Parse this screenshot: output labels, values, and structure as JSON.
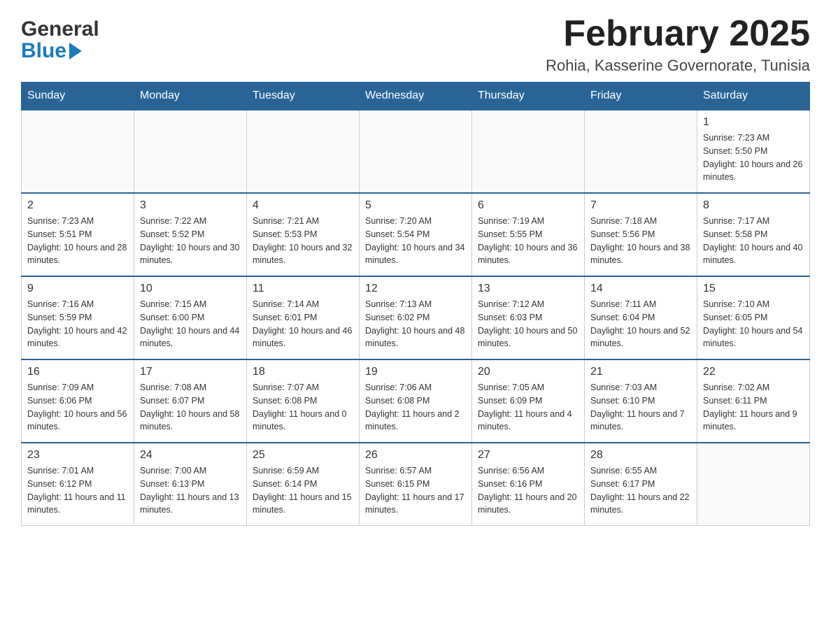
{
  "header": {
    "logo_general": "General",
    "logo_blue": "Blue",
    "month_title": "February 2025",
    "location": "Rohia, Kasserine Governorate, Tunisia"
  },
  "days_of_week": [
    "Sunday",
    "Monday",
    "Tuesday",
    "Wednesday",
    "Thursday",
    "Friday",
    "Saturday"
  ],
  "weeks": [
    {
      "days": [
        {
          "number": "",
          "sunrise": "",
          "sunset": "",
          "daylight": ""
        },
        {
          "number": "",
          "sunrise": "",
          "sunset": "",
          "daylight": ""
        },
        {
          "number": "",
          "sunrise": "",
          "sunset": "",
          "daylight": ""
        },
        {
          "number": "",
          "sunrise": "",
          "sunset": "",
          "daylight": ""
        },
        {
          "number": "",
          "sunrise": "",
          "sunset": "",
          "daylight": ""
        },
        {
          "number": "",
          "sunrise": "",
          "sunset": "",
          "daylight": ""
        },
        {
          "number": "1",
          "sunrise": "Sunrise: 7:23 AM",
          "sunset": "Sunset: 5:50 PM",
          "daylight": "Daylight: 10 hours and 26 minutes."
        }
      ]
    },
    {
      "days": [
        {
          "number": "2",
          "sunrise": "Sunrise: 7:23 AM",
          "sunset": "Sunset: 5:51 PM",
          "daylight": "Daylight: 10 hours and 28 minutes."
        },
        {
          "number": "3",
          "sunrise": "Sunrise: 7:22 AM",
          "sunset": "Sunset: 5:52 PM",
          "daylight": "Daylight: 10 hours and 30 minutes."
        },
        {
          "number": "4",
          "sunrise": "Sunrise: 7:21 AM",
          "sunset": "Sunset: 5:53 PM",
          "daylight": "Daylight: 10 hours and 32 minutes."
        },
        {
          "number": "5",
          "sunrise": "Sunrise: 7:20 AM",
          "sunset": "Sunset: 5:54 PM",
          "daylight": "Daylight: 10 hours and 34 minutes."
        },
        {
          "number": "6",
          "sunrise": "Sunrise: 7:19 AM",
          "sunset": "Sunset: 5:55 PM",
          "daylight": "Daylight: 10 hours and 36 minutes."
        },
        {
          "number": "7",
          "sunrise": "Sunrise: 7:18 AM",
          "sunset": "Sunset: 5:56 PM",
          "daylight": "Daylight: 10 hours and 38 minutes."
        },
        {
          "number": "8",
          "sunrise": "Sunrise: 7:17 AM",
          "sunset": "Sunset: 5:58 PM",
          "daylight": "Daylight: 10 hours and 40 minutes."
        }
      ]
    },
    {
      "days": [
        {
          "number": "9",
          "sunrise": "Sunrise: 7:16 AM",
          "sunset": "Sunset: 5:59 PM",
          "daylight": "Daylight: 10 hours and 42 minutes."
        },
        {
          "number": "10",
          "sunrise": "Sunrise: 7:15 AM",
          "sunset": "Sunset: 6:00 PM",
          "daylight": "Daylight: 10 hours and 44 minutes."
        },
        {
          "number": "11",
          "sunrise": "Sunrise: 7:14 AM",
          "sunset": "Sunset: 6:01 PM",
          "daylight": "Daylight: 10 hours and 46 minutes."
        },
        {
          "number": "12",
          "sunrise": "Sunrise: 7:13 AM",
          "sunset": "Sunset: 6:02 PM",
          "daylight": "Daylight: 10 hours and 48 minutes."
        },
        {
          "number": "13",
          "sunrise": "Sunrise: 7:12 AM",
          "sunset": "Sunset: 6:03 PM",
          "daylight": "Daylight: 10 hours and 50 minutes."
        },
        {
          "number": "14",
          "sunrise": "Sunrise: 7:11 AM",
          "sunset": "Sunset: 6:04 PM",
          "daylight": "Daylight: 10 hours and 52 minutes."
        },
        {
          "number": "15",
          "sunrise": "Sunrise: 7:10 AM",
          "sunset": "Sunset: 6:05 PM",
          "daylight": "Daylight: 10 hours and 54 minutes."
        }
      ]
    },
    {
      "days": [
        {
          "number": "16",
          "sunrise": "Sunrise: 7:09 AM",
          "sunset": "Sunset: 6:06 PM",
          "daylight": "Daylight: 10 hours and 56 minutes."
        },
        {
          "number": "17",
          "sunrise": "Sunrise: 7:08 AM",
          "sunset": "Sunset: 6:07 PM",
          "daylight": "Daylight: 10 hours and 58 minutes."
        },
        {
          "number": "18",
          "sunrise": "Sunrise: 7:07 AM",
          "sunset": "Sunset: 6:08 PM",
          "daylight": "Daylight: 11 hours and 0 minutes."
        },
        {
          "number": "19",
          "sunrise": "Sunrise: 7:06 AM",
          "sunset": "Sunset: 6:08 PM",
          "daylight": "Daylight: 11 hours and 2 minutes."
        },
        {
          "number": "20",
          "sunrise": "Sunrise: 7:05 AM",
          "sunset": "Sunset: 6:09 PM",
          "daylight": "Daylight: 11 hours and 4 minutes."
        },
        {
          "number": "21",
          "sunrise": "Sunrise: 7:03 AM",
          "sunset": "Sunset: 6:10 PM",
          "daylight": "Daylight: 11 hours and 7 minutes."
        },
        {
          "number": "22",
          "sunrise": "Sunrise: 7:02 AM",
          "sunset": "Sunset: 6:11 PM",
          "daylight": "Daylight: 11 hours and 9 minutes."
        }
      ]
    },
    {
      "days": [
        {
          "number": "23",
          "sunrise": "Sunrise: 7:01 AM",
          "sunset": "Sunset: 6:12 PM",
          "daylight": "Daylight: 11 hours and 11 minutes."
        },
        {
          "number": "24",
          "sunrise": "Sunrise: 7:00 AM",
          "sunset": "Sunset: 6:13 PM",
          "daylight": "Daylight: 11 hours and 13 minutes."
        },
        {
          "number": "25",
          "sunrise": "Sunrise: 6:59 AM",
          "sunset": "Sunset: 6:14 PM",
          "daylight": "Daylight: 11 hours and 15 minutes."
        },
        {
          "number": "26",
          "sunrise": "Sunrise: 6:57 AM",
          "sunset": "Sunset: 6:15 PM",
          "daylight": "Daylight: 11 hours and 17 minutes."
        },
        {
          "number": "27",
          "sunrise": "Sunrise: 6:56 AM",
          "sunset": "Sunset: 6:16 PM",
          "daylight": "Daylight: 11 hours and 20 minutes."
        },
        {
          "number": "28",
          "sunrise": "Sunrise: 6:55 AM",
          "sunset": "Sunset: 6:17 PM",
          "daylight": "Daylight: 11 hours and 22 minutes."
        },
        {
          "number": "",
          "sunrise": "",
          "sunset": "",
          "daylight": ""
        }
      ]
    }
  ]
}
